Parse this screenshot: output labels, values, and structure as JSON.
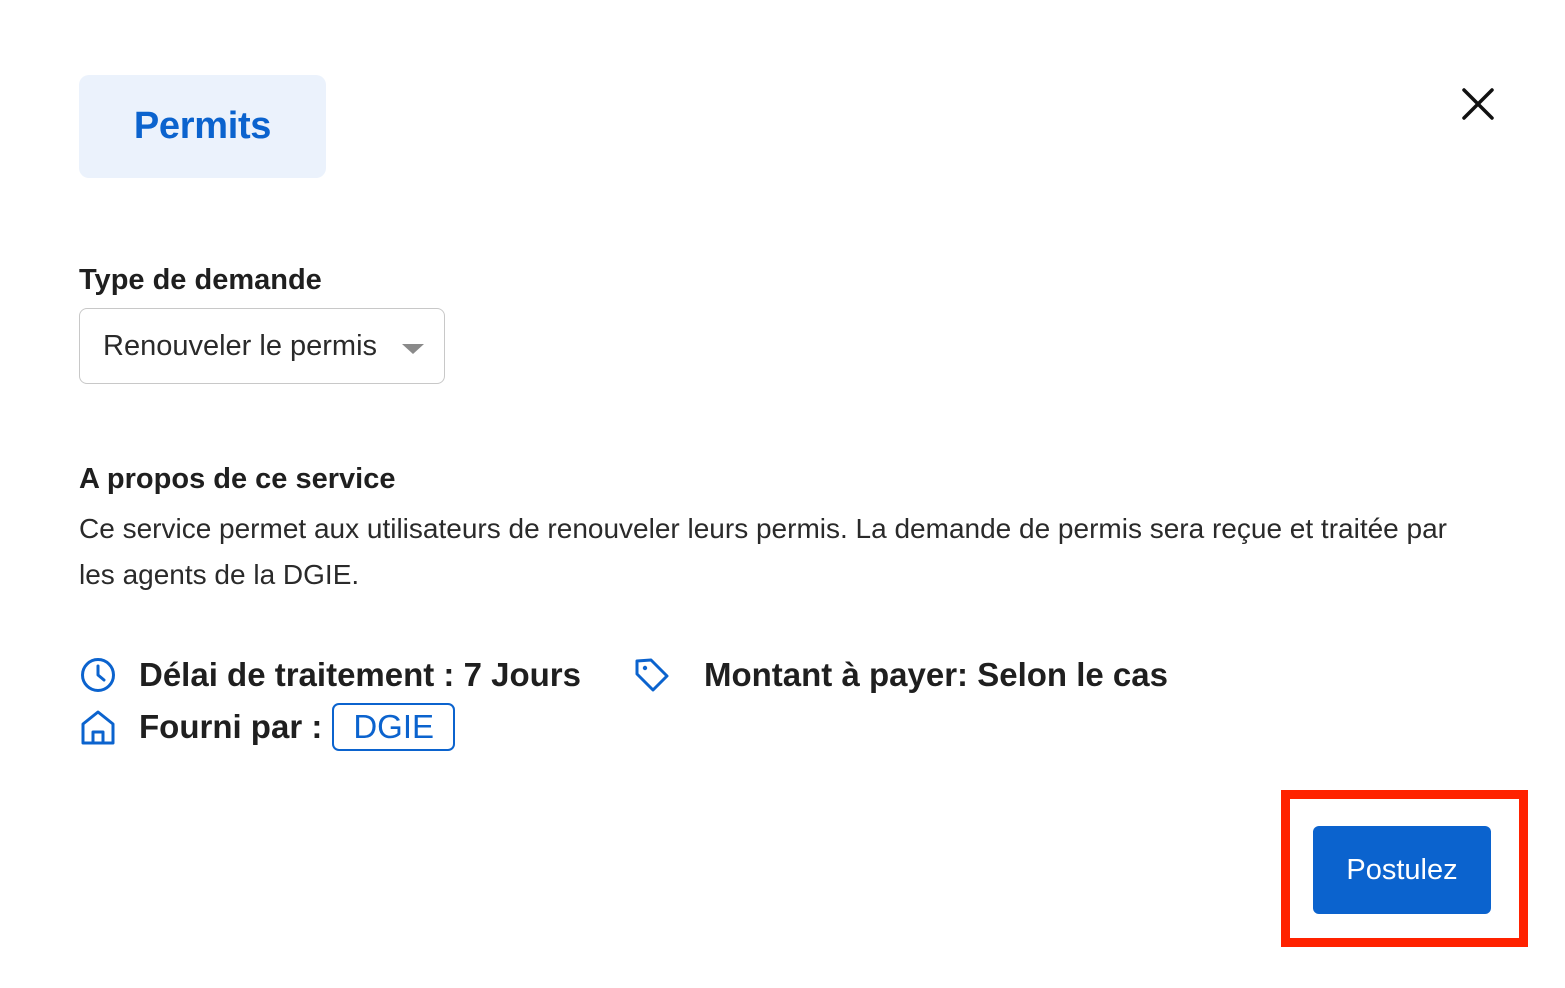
{
  "category": {
    "label": "Permits"
  },
  "close": {
    "icon": "close-icon"
  },
  "request_type": {
    "label": "Type de demande",
    "selected_value": "Renouveler le permis"
  },
  "about": {
    "title": "A propos de ce service",
    "description": "Ce service permet aux utilisateurs de renouveler leurs permis. La demande de permis sera reçue et traitée par les agents de la DGIE."
  },
  "meta": {
    "processing_time": "Délai de traitement : 7 Jours",
    "amount": "Montant à payer: Selon le cas",
    "provider_label": "Fourni par :",
    "provider_name": "DGIE"
  },
  "actions": {
    "apply_label": "Postulez"
  },
  "colors": {
    "accent": "#0b63ce",
    "tag_background": "#ebf2fc",
    "highlight": "#ff2200"
  }
}
